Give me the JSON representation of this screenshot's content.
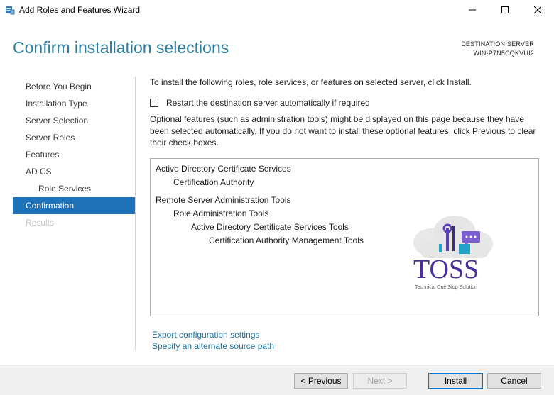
{
  "window": {
    "title": "Add Roles and Features Wizard",
    "minimize_icon": "minimize-icon",
    "maximize_icon": "maximize-icon",
    "close_icon": "close-icon"
  },
  "header": {
    "title": "Confirm installation selections",
    "dest_label": "DESTINATION SERVER",
    "dest_server": "WIN-P7N5CQKVUI2"
  },
  "nav": {
    "items": [
      {
        "label": "Before You Begin",
        "state": "normal"
      },
      {
        "label": "Installation Type",
        "state": "normal"
      },
      {
        "label": "Server Selection",
        "state": "normal"
      },
      {
        "label": "Server Roles",
        "state": "normal"
      },
      {
        "label": "Features",
        "state": "normal"
      },
      {
        "label": "AD CS",
        "state": "normal"
      },
      {
        "label": "Role Services",
        "state": "normal"
      },
      {
        "label": "Confirmation",
        "state": "active"
      },
      {
        "label": "Results",
        "state": "disabled"
      }
    ]
  },
  "content": {
    "intro": "To install the following roles, role services, or features on selected server, click Install.",
    "restart_label": "Restart the destination server automatically if required",
    "restart_checked": false,
    "optional_text": "Optional features (such as administration tools) might be displayed on this page because they have been selected automatically. If you do not want to install these optional features, click Previous to clear their check boxes.",
    "selections": [
      {
        "label": "Active Directory Certificate Services",
        "level": 0
      },
      {
        "label": "Certification Authority",
        "level": 1
      },
      {
        "label": "Remote Server Administration Tools",
        "level": 0
      },
      {
        "label": "Role Administration Tools",
        "level": 1
      },
      {
        "label": "Active Directory Certificate Services Tools",
        "level": 2
      },
      {
        "label": "Certification Authority Management Tools",
        "level": 3
      }
    ],
    "export_link": "Export configuration settings",
    "source_link": "Specify an alternate source path"
  },
  "watermark": {
    "brand": "TOSS",
    "tagline": "Technical One Stop Solution"
  },
  "footer": {
    "previous": "< Previous",
    "next": "Next >",
    "install": "Install",
    "cancel": "Cancel"
  },
  "colors": {
    "accent": "#1f72b8",
    "title": "#2b7fa0",
    "link": "#1b6ea0"
  }
}
